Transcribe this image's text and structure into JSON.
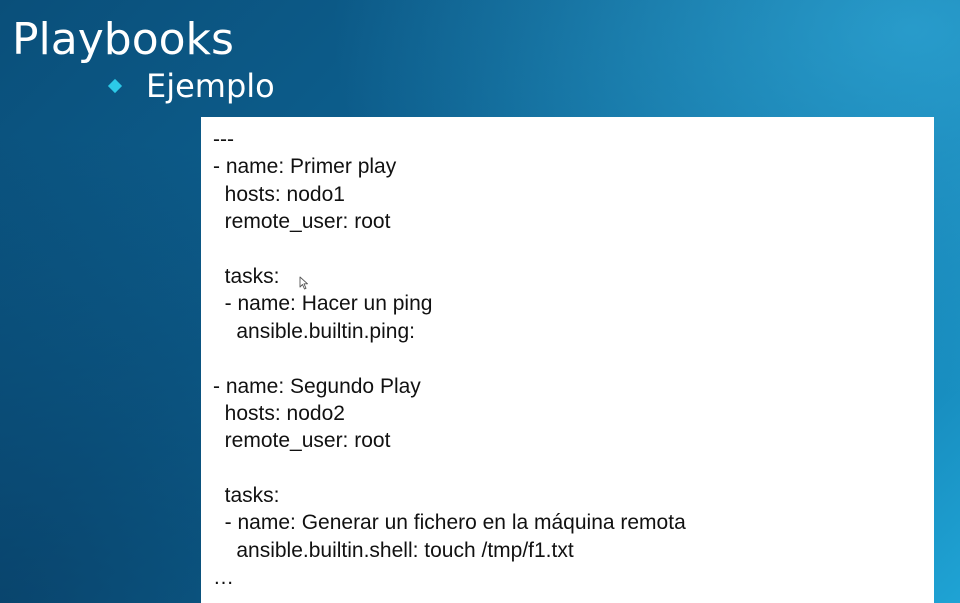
{
  "slide": {
    "title": "Playbooks",
    "bullet": "Ejemplo",
    "code_lines": [
      "---",
      "- name: Primer play",
      "  hosts: nodo1",
      "  remote_user: root",
      "",
      "  tasks:",
      "  - name: Hacer un ping",
      "    ansible.builtin.ping:",
      "",
      "- name: Segundo Play",
      "  hosts: nodo2",
      "  remote_user: root",
      "",
      "  tasks:",
      "  - name: Generar un fichero en la máquina remota",
      "    ansible.builtin.shell: touch /tmp/f1.txt",
      "…"
    ]
  },
  "colors": {
    "bullet": "#2cc9e8",
    "background_dark": "#0a4f7a",
    "background_light": "#1fa3d4"
  },
  "icons": {
    "bullet": "diamond-bullet-icon",
    "cursor": "mouse-pointer-icon"
  }
}
